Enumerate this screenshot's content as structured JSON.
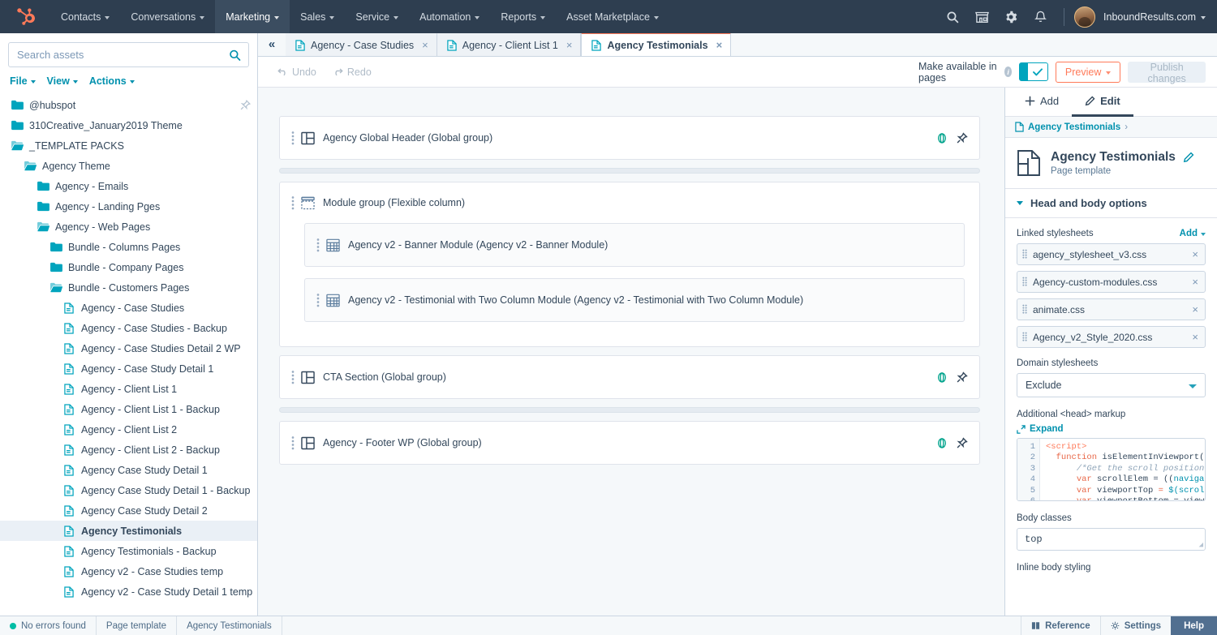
{
  "topnav": {
    "logo": "hubspot-sprocket-logo",
    "items": [
      {
        "label": "Contacts",
        "caret": true,
        "active": false
      },
      {
        "label": "Conversations",
        "caret": true,
        "active": false
      },
      {
        "label": "Marketing",
        "caret": true,
        "active": true
      },
      {
        "label": "Sales",
        "caret": true,
        "active": false
      },
      {
        "label": "Service",
        "caret": true,
        "active": false
      },
      {
        "label": "Automation",
        "caret": true,
        "active": false
      },
      {
        "label": "Reports",
        "caret": true,
        "active": false
      },
      {
        "label": "Asset Marketplace",
        "caret": true,
        "active": false
      }
    ],
    "icons": [
      "search-icon",
      "marketplace-icon",
      "gear-icon",
      "notifications-bell-icon"
    ],
    "account_name": "InboundResults.com"
  },
  "sidebar": {
    "search": {
      "value": "",
      "placeholder": "Search assets"
    },
    "menus": [
      {
        "label": "File"
      },
      {
        "label": "View"
      },
      {
        "label": "Actions"
      }
    ],
    "tree": [
      {
        "label": "@hubspot",
        "type": "folder-closed",
        "depth": 0,
        "pin": true
      },
      {
        "label": "310Creative_January2019 Theme",
        "type": "folder-closed",
        "depth": 0
      },
      {
        "label": "_TEMPLATE PACKS",
        "type": "folder-open",
        "depth": 0
      },
      {
        "label": "Agency Theme",
        "type": "folder-open",
        "depth": 1
      },
      {
        "label": "Agency - Emails",
        "type": "folder-closed",
        "depth": 2
      },
      {
        "label": "Agency - Landing Pges",
        "type": "folder-closed",
        "depth": 2
      },
      {
        "label": "Agency - Web Pages",
        "type": "folder-open",
        "depth": 2
      },
      {
        "label": "Bundle - Columns Pages",
        "type": "folder-closed",
        "depth": 3
      },
      {
        "label": "Bundle - Company Pages",
        "type": "folder-closed",
        "depth": 3
      },
      {
        "label": "Bundle - Customers Pages",
        "type": "folder-open",
        "depth": 3
      },
      {
        "label": "Agency - Case Studies",
        "type": "file",
        "depth": 4
      },
      {
        "label": "Agency - Case Studies - Backup",
        "type": "file",
        "depth": 4
      },
      {
        "label": "Agency - Case Studies Detail 2 WP",
        "type": "file",
        "depth": 4
      },
      {
        "label": "Agency - Case Study Detail 1",
        "type": "file",
        "depth": 4
      },
      {
        "label": "Agency - Client List 1",
        "type": "file",
        "depth": 4
      },
      {
        "label": "Agency - Client List 1 - Backup",
        "type": "file",
        "depth": 4
      },
      {
        "label": "Agency - Client List 2",
        "type": "file",
        "depth": 4
      },
      {
        "label": "Agency - Client List 2 - Backup",
        "type": "file",
        "depth": 4
      },
      {
        "label": "Agency Case Study Detail 1",
        "type": "file",
        "depth": 4
      },
      {
        "label": "Agency Case Study Detail 1 - Backup",
        "type": "file",
        "depth": 4
      },
      {
        "label": "Agency Case Study Detail 2",
        "type": "file",
        "depth": 4
      },
      {
        "label": "Agency Testimonials",
        "type": "file",
        "depth": 4,
        "selected": true
      },
      {
        "label": "Agency Testimonials - Backup",
        "type": "file",
        "depth": 4
      },
      {
        "label": "Agency v2 - Case Studies temp",
        "type": "file",
        "depth": 4
      },
      {
        "label": "Agency v2 - Case Study Detail 1 temp",
        "type": "file",
        "depth": 4
      }
    ]
  },
  "tabstrip": {
    "collapse_icon": "double-chevron-left-icon",
    "tabs": [
      {
        "label": "Agency - Case Studies",
        "active": false,
        "close": "×"
      },
      {
        "label": "Agency - Client List 1",
        "active": false,
        "close": "×"
      },
      {
        "label": "Agency Testimonials",
        "active": true,
        "close": "×"
      }
    ]
  },
  "toolbar": {
    "undo_label": "Undo",
    "redo_label": "Redo",
    "available_label": "Make available in pages",
    "toggle_on": true,
    "toggle_check": "✓",
    "preview_label": "Preview",
    "publish_label": "Publish changes"
  },
  "canvas": {
    "modules": [
      {
        "kind": "global",
        "label": "Agency Global Header (Global group)",
        "icon": "layout-sidebar-icon",
        "actions": [
          "globe-icon",
          "unlink-pin-icon"
        ]
      },
      {
        "kind": "spacer"
      },
      {
        "kind": "group",
        "label": "Module group (Flexible column)",
        "icon": "flexible-column-icon",
        "children": [
          {
            "label": "Agency v2 - Banner Module (Agency v2 - Banner Module)",
            "icon": "grid-module-icon"
          },
          {
            "label": "Agency v2 - Testimonial with Two Column Module (Agency v2 - Testimonial with Two Column Module)",
            "icon": "grid-module-icon"
          }
        ]
      },
      {
        "kind": "global",
        "label": "CTA Section (Global group)",
        "icon": "layout-sidebar-icon",
        "actions": [
          "globe-icon",
          "unlink-pin-icon"
        ]
      },
      {
        "kind": "spacer"
      },
      {
        "kind": "global",
        "label": "Agency - Footer WP (Global group)",
        "icon": "layout-sidebar-icon",
        "actions": [
          "globe-icon",
          "unlink-pin-icon"
        ]
      }
    ]
  },
  "rightpanel": {
    "tabs": [
      {
        "label": "Add",
        "icon": "plus-icon",
        "active": false
      },
      {
        "label": "Edit",
        "icon": "pencil-icon",
        "active": true
      }
    ],
    "breadcrumb": {
      "label": "Agency Testimonials",
      "chevron": "›"
    },
    "title": "Agency Testimonials",
    "subtitle": "Page template",
    "edit_icon": "pencil-icon",
    "section_title": "Head and body options",
    "stylesheets_label": "Linked stylesheets",
    "add_label": "Add",
    "stylesheets": [
      {
        "name": "agency_stylesheet_v3.css"
      },
      {
        "name": "Agency-custom-modules.css"
      },
      {
        "name": "animate.css"
      },
      {
        "name": "Agency_v2_Style_2020.css"
      }
    ],
    "domain_label": "Domain stylesheets",
    "domain_value": "Exclude",
    "head_markup_label": "Additional <head> markup",
    "expand_label": "Expand",
    "code": {
      "line_numbers": [
        "1",
        "2",
        "3",
        "4",
        "5",
        "6"
      ],
      "lines": [
        "<script>",
        "  function isElementInViewport(ele",
        "      /*Get the scroll position o",
        "      var scrollElem = ((navigato",
        "      var viewportTop = $(scrollE",
        "      var viewportBottom = viewpo"
      ]
    },
    "body_classes_label": "Body classes",
    "body_classes_value": "top",
    "inline_body_label": "Inline body styling"
  },
  "statusbar": {
    "left": [
      {
        "label": "No errors found",
        "dot": true
      },
      {
        "label": "Page template"
      },
      {
        "label": "Agency Testimonials"
      }
    ],
    "right": [
      {
        "label": "Reference",
        "icon": "book-icon"
      },
      {
        "label": "Settings",
        "icon": "gear-icon"
      }
    ],
    "help_label": "Help"
  },
  "colors": {
    "nav_bg": "#2e3e50",
    "accent_orange": "#ff7a59",
    "accent_teal": "#0091ae",
    "toggle_teal": "#00a4bd",
    "success_green": "#00bda5",
    "help_purple": "#516f90"
  }
}
